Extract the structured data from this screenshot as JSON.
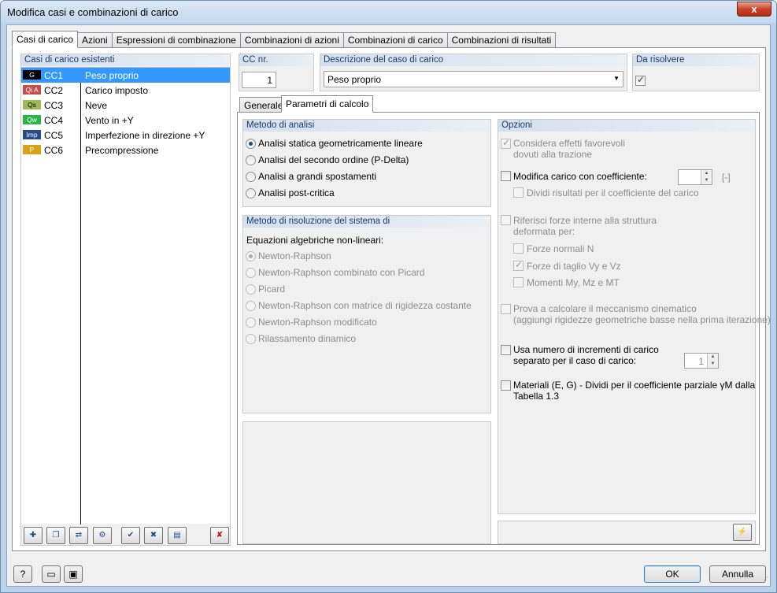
{
  "window": {
    "title": "Modifica casi e combinazioni di carico",
    "close_glyph": "x"
  },
  "tabs": [
    "Casi di carico",
    "Azioni",
    "Espressioni di combinazione",
    "Combinazioni di azioni",
    "Combinazioni di carico",
    "Combinazioni di risultati"
  ],
  "left": {
    "title": "Casi di carico esistenti",
    "rows": [
      {
        "badge": "G",
        "badge_color": "#000000",
        "badge_text_color": "#ffffff",
        "id": "CC1",
        "desc": "Peso proprio"
      },
      {
        "badge": "Qi A",
        "badge_color": "#c0504d",
        "badge_text_color": "#ffffff",
        "id": "CC2",
        "desc": "Carico imposto"
      },
      {
        "badge": "Qs",
        "badge_color": "#9bbb59",
        "badge_text_color": "#000000",
        "id": "CC3",
        "desc": "Neve"
      },
      {
        "badge": "Qw",
        "badge_color": "#2db34a",
        "badge_text_color": "#ffffff",
        "id": "CC4",
        "desc": "Vento in +Y"
      },
      {
        "badge": "Imp",
        "badge_color": "#2a4b8a",
        "badge_text_color": "#ffffff",
        "id": "CC5",
        "desc": "Imperfezione in direzione +Y"
      },
      {
        "badge": "P",
        "badge_color": "#d6a21a",
        "badge_text_color": "#ffffff",
        "id": "CC6",
        "desc": "Precompressione"
      }
    ],
    "tools": [
      "new-loadcase-icon",
      "copy-loadcase-icon",
      "renumber-icon",
      "generate-icon",
      "check-all-icon",
      "uncheck-all-icon",
      "to-solve-icon",
      "delete-icon"
    ]
  },
  "cc": {
    "label": "CC nr.",
    "value": "1"
  },
  "descr": {
    "label": "Descrizione del caso di carico",
    "value": "Peso proprio"
  },
  "solve": {
    "label": "Da risolvere",
    "checked": true
  },
  "subtabs": [
    "Generale",
    "Parametri di calcolo"
  ],
  "analysis": {
    "title": "Metodo di analisi",
    "options": [
      "Analisi statica geometricamente lineare",
      "Analisi del secondo ordine (P-Delta)",
      "Analisi a grandi spostamenti",
      "Analisi post-critica"
    ],
    "selected": 0
  },
  "solver": {
    "title": "Metodo di risoluzione del sistema di",
    "subtitle": "Equazioni algebriche non-lineari:",
    "options": [
      "Newton-Raphson",
      "Newton-Raphson combinato con Picard",
      "Picard",
      "Newton-Raphson con matrice di rigidezza costante",
      "Newton-Raphson modificato",
      "Rilassamento dinamico"
    ],
    "selected": 0
  },
  "options": {
    "title": "Opzioni",
    "favorable_1": "Considera effetti favorevoli",
    "favorable_2": "dovuti alla trazione",
    "modify_load": "Modifica carico con coefficiente:",
    "unit": "[-]",
    "divide_results": "Dividi risultati per il coefficiente del carico",
    "refer_1": "Riferisci forze interne alla struttura",
    "refer_2": "deformata per:",
    "normal_forces": "Forze normali N",
    "shear_forces": "Forze di taglio Vy e Vz",
    "moments": "Momenti My, Mz e MT",
    "kinematic_1": "Prova a calcolare il meccanismo cinematico",
    "kinematic_2": "(aggiungi rigidezze geometriche basse nella prima iterazione)",
    "increments_1": "Usa numero di incrementi di carico",
    "increments_2": "separato per il caso di carico:",
    "increments_value": "1",
    "materials_1": "Materiali (E, G) - Dividi per il coefficiente parziale γM dalla",
    "materials_2": "Tabella 1.3"
  },
  "footer": {
    "ok": "OK",
    "cancel": "Annulla",
    "dropdown_glyph": "▼"
  }
}
